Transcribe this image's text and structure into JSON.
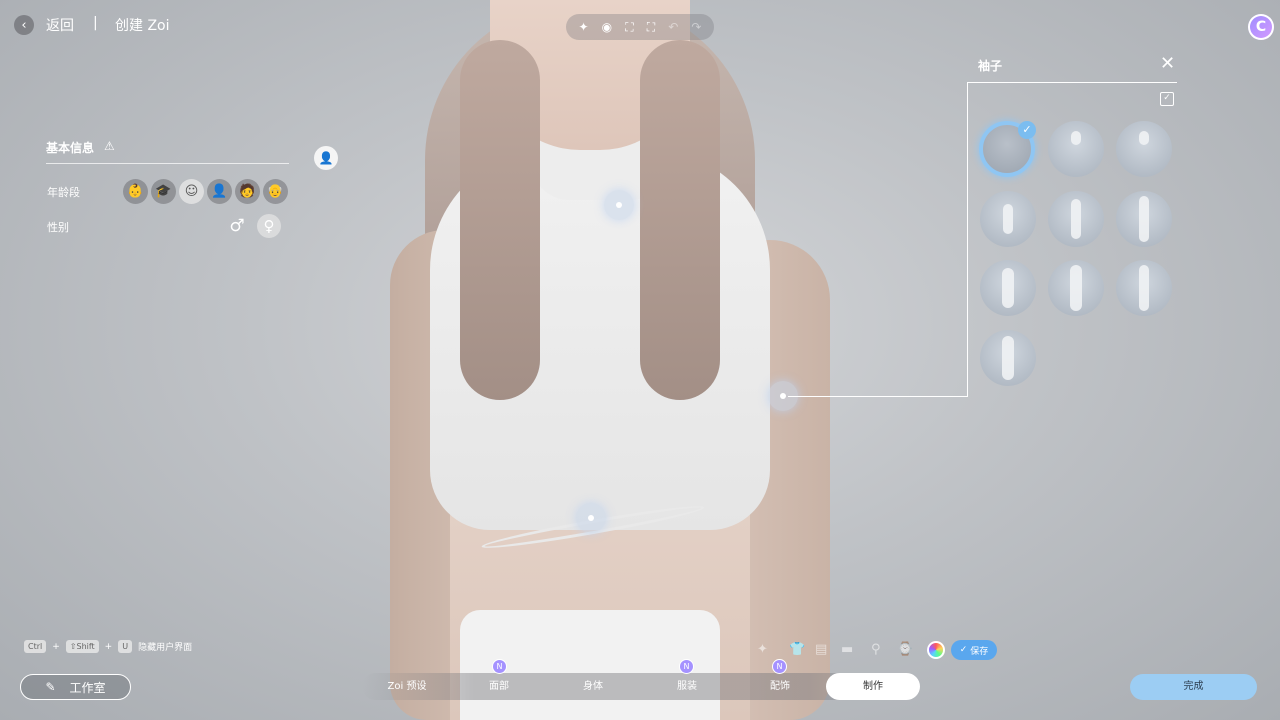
{
  "header": {
    "back_icon": "chevron-left-icon",
    "back_label": "返回",
    "separator": "|",
    "create_label": "创建 Zoi"
  },
  "top_tools": [
    {
      "name": "sparkle-icon",
      "glyph": "✦"
    },
    {
      "name": "camera-icon",
      "glyph": "◉"
    },
    {
      "name": "frame-icon",
      "glyph": "⛶"
    },
    {
      "name": "face-scan-icon",
      "glyph": "⛶"
    },
    {
      "name": "undo-icon",
      "glyph": "↶"
    },
    {
      "name": "redo-icon",
      "glyph": "↷"
    }
  ],
  "avatar_badge": "C",
  "basic_info": {
    "title": "基本信息",
    "warn_icon": "⚠",
    "age_label": "年龄段",
    "gender_label": "性别",
    "age_icons": [
      "👶",
      "🎓",
      "☺",
      "👤",
      "🧑",
      "👴"
    ],
    "selected_age_index": 2,
    "male_glyph": "♂",
    "female_glyph": "♀",
    "selected_gender": "female",
    "user_edit_glyph": "👤"
  },
  "sleeves_panel": {
    "title": "袖子",
    "close_glyph": "✕",
    "save_glyph": "✓",
    "check_glyph": "✓",
    "item_count": 10,
    "selected_index": 0
  },
  "shortcut": {
    "key1": "Ctrl",
    "plus": "+",
    "key2": "⇧Shift",
    "key3": "U",
    "label": "隐藏用户界面"
  },
  "workshop": {
    "icon": "✎",
    "label": "工作室"
  },
  "quickbar": {
    "icons": [
      "✦",
      "👕",
      "▤",
      "▬",
      "⚲",
      "⌚"
    ],
    "save_label": "保存",
    "save_check": "✓"
  },
  "tabs": [
    {
      "label": "Zoi 预设",
      "badge": ""
    },
    {
      "label": "面部",
      "badge": "N"
    },
    {
      "label": "身体",
      "badge": ""
    },
    {
      "label": "服装",
      "badge": "N"
    },
    {
      "label": "配饰",
      "badge": "N"
    },
    {
      "label": "制作",
      "badge": ""
    }
  ],
  "active_tab": 5,
  "done_label": "完成",
  "colors": {
    "accent_blue": "#5aa7ee",
    "done_blue": "#9ccdf3",
    "badge_purple": "#a592ff",
    "selection_ring": "#8fc6f3"
  }
}
